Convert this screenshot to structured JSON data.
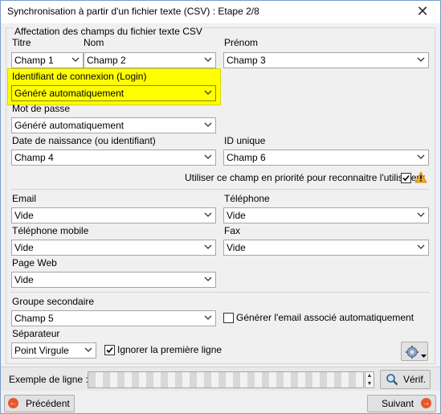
{
  "window": {
    "title": "Synchronisation à partir d'un fichier texte (CSV) : Etape 2/8",
    "close_glyph": "✕"
  },
  "group": {
    "title": "Affectation des champs du fichier texte CSV"
  },
  "fields": {
    "titre": {
      "label": "Titre",
      "value": "Champ 1"
    },
    "nom": {
      "label": "Nom",
      "value": "Champ 2"
    },
    "prenom": {
      "label": "Prénom",
      "value": "Champ 3"
    },
    "login": {
      "label": "Identifiant de connexion (Login)",
      "value": "Généré automatiquement",
      "highlight_color": "#ffff00"
    },
    "password": {
      "label": "Mot de passe",
      "value": "Généré automatiquement"
    },
    "birthdate": {
      "label": "Date de naissance (ou identifiant)",
      "value": "Champ 4"
    },
    "unique_id": {
      "label": "ID unique",
      "value": "Champ 6"
    },
    "priority": {
      "label": "Utiliser ce champ en priorité pour reconnaitre l'utilisateur",
      "checked": true,
      "icon": "warning-icon"
    },
    "email": {
      "label": "Email",
      "value": "Vide"
    },
    "phone": {
      "label": "Téléphone",
      "value": "Vide"
    },
    "mobile": {
      "label": "Téléphone mobile",
      "value": "Vide"
    },
    "fax": {
      "label": "Fax",
      "value": "Vide"
    },
    "webpage": {
      "label": "Page Web",
      "value": "Vide"
    },
    "secondary_group": {
      "label": "Groupe secondaire",
      "value": "Champ 5"
    },
    "gen_email": {
      "label": "Générer l'email associé automatiquement",
      "checked": false
    },
    "separator": {
      "label": "Séparateur",
      "value": "Point Virgule"
    },
    "ignore_first": {
      "label": "Ignorer la première ligne",
      "checked": true
    }
  },
  "example": {
    "label": "Exemple de ligne :",
    "verify_label": "Vérif."
  },
  "nav": {
    "previous_label": "Précédent",
    "next_label": "Suivant"
  },
  "icons": [
    "close-icon",
    "chevron-down-icon",
    "check-icon",
    "warning-icon",
    "gear-icon",
    "magnifier-icon",
    "arrow-left-icon",
    "arrow-right-icon"
  ]
}
